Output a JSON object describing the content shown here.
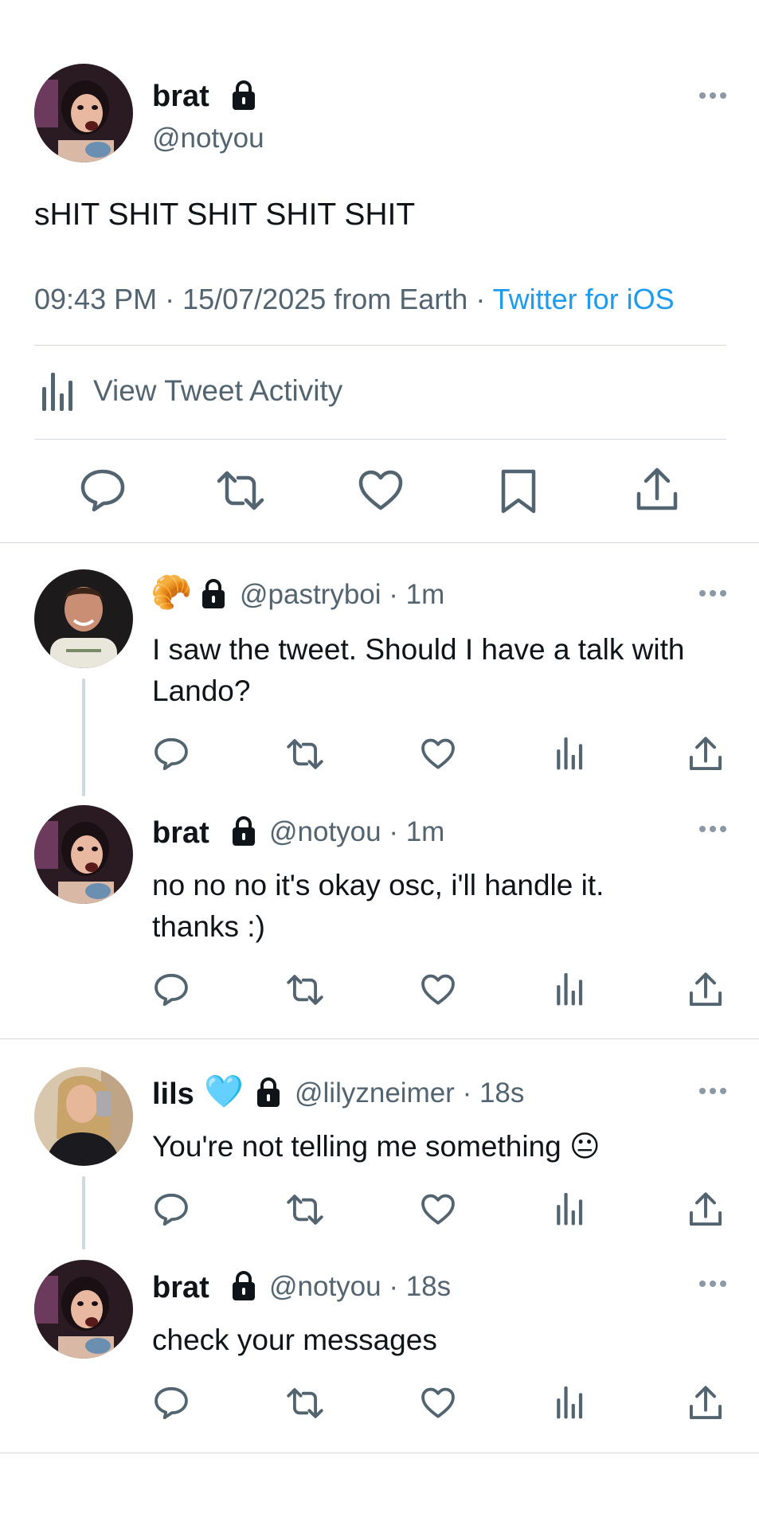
{
  "main_tweet": {
    "name": "brat",
    "handle": "@notyou",
    "text": "sHIT SHIT SHIT SHIT SHIT",
    "timestamp": "09:43 PM · 15/07/2025 from Earth",
    "separator": " · ",
    "source": "Twitter for iOS",
    "activity_label": "View Tweet Activity"
  },
  "replies": [
    {
      "emoji": "🥐",
      "handle_meta": "@pastryboi · 1m",
      "text_line1": "I saw the tweet. Should I have a talk with",
      "text_line2": "Lando?"
    },
    {
      "name": "brat",
      "handle_meta": "@notyou · 1m",
      "text_line1": "no no no it's okay osc, i'll handle it.",
      "text_line2": "thanks :)"
    },
    {
      "name": "lils",
      "emoji": "🩵",
      "handle_meta": "@lilyzneimer · 18s",
      "text_line1": "You're not telling me something",
      "text_emoji": "😐"
    },
    {
      "name": "brat",
      "handle_meta": "@notyou · 18s",
      "text_line1": "check your messages"
    }
  ],
  "icons": {
    "reply": "speech-bubble-icon",
    "retweet": "retweet-arrows-icon",
    "like": "heart-icon",
    "bookmark": "bookmark-icon",
    "share": "share-upload-icon",
    "views": "bar-chart-icon",
    "more": "ellipsis-icon",
    "lock": "padlock-icon"
  },
  "colors": {
    "text": "#0f1419",
    "secondary": "#536471",
    "link": "#1d9bf0",
    "divider": "#cfd9de"
  }
}
